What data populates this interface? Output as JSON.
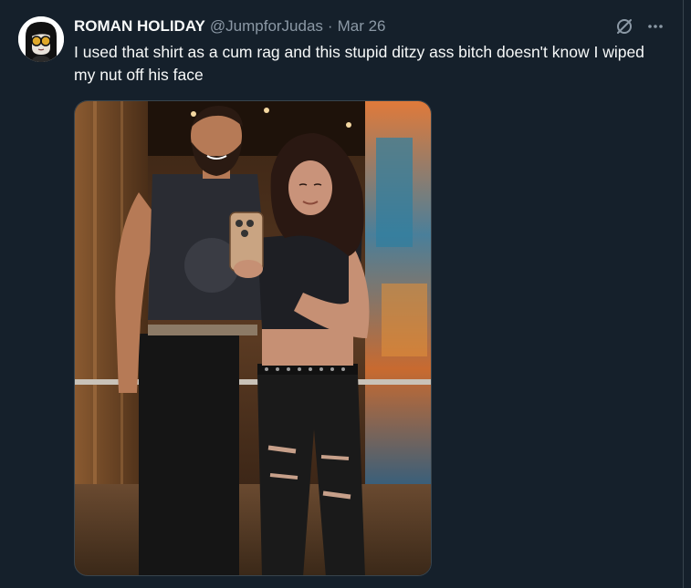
{
  "tweet": {
    "display_name": "ROMAN HOLIDAY",
    "handle": "@JumpforJudas",
    "separator": "·",
    "date": "Mar 26",
    "text": "I used that shirt as a cum rag and this stupid ditzy ass bitch doesn't know I wiped my nut off his face"
  },
  "icons": {
    "grok": "slashed-circle-icon",
    "more": "more-horizontal-icon"
  },
  "colors": {
    "background": "#15202b",
    "primary_text": "#f7f9f9",
    "secondary_text": "#8b98a5",
    "border": "#38444d"
  }
}
